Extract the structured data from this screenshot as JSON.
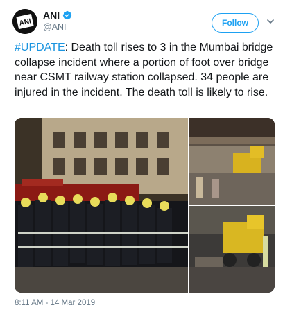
{
  "account": {
    "display_name": "ANI",
    "handle": "@ANI",
    "verified": true,
    "avatar_text": "ANI",
    "avatar_icon": "ani-logo-icon"
  },
  "follow_button": {
    "label": "Follow"
  },
  "menu_icon": "chevron-down-icon",
  "tweet": {
    "hashtag": "#UPDATE",
    "body": ": Death toll rises to 3 in the Mumbai bridge collapse incident where a portion of foot over bridge near CSMT railway station collapsed. 34 people are injured in the incident. The death toll is likely to rise."
  },
  "media": {
    "images": [
      {
        "description_icon": "photo-firefighters-icon"
      },
      {
        "description_icon": "photo-bulldozer-icon"
      },
      {
        "description_icon": "photo-excavator-icon"
      }
    ]
  },
  "timestamp": "8:11 AM - 14 Mar 2019",
  "colors": {
    "accent": "#1da1f2",
    "hashtag": "#1b95e0",
    "muted": "#657786",
    "text": "#14171a"
  }
}
